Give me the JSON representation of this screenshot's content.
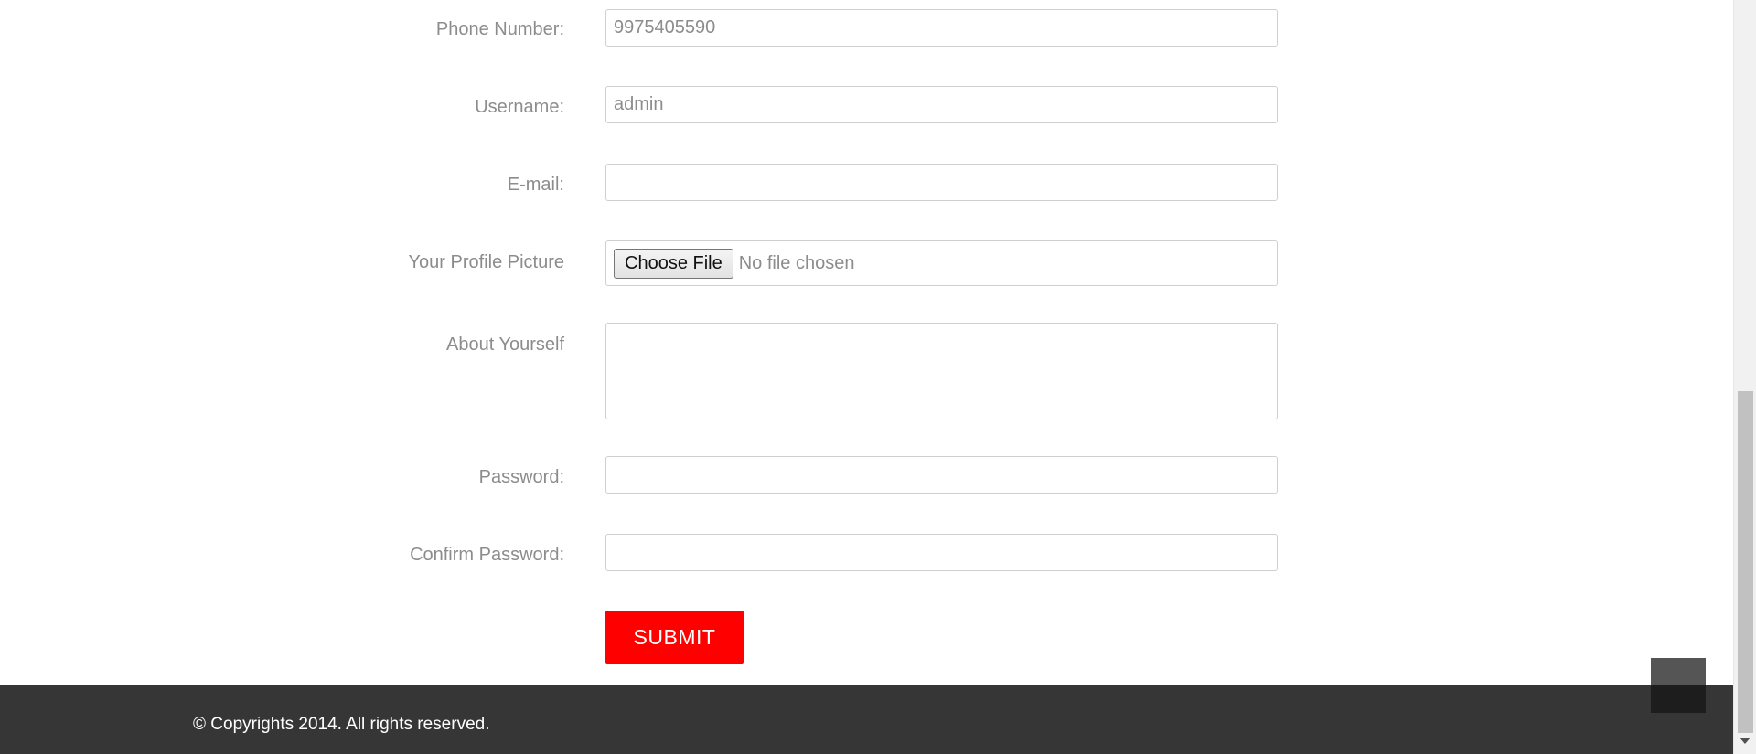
{
  "form": {
    "phone": {
      "label": "Phone Number:",
      "value": "9975405590"
    },
    "username": {
      "label": "Username:",
      "value": "admin"
    },
    "email": {
      "label": "E-mail:",
      "value": ""
    },
    "profile_picture": {
      "label": "Your Profile Picture",
      "button_label": "Choose File",
      "status": "No file chosen"
    },
    "about": {
      "label": "About Yourself",
      "value": ""
    },
    "password": {
      "label": "Password:",
      "value": ""
    },
    "confirm_password": {
      "label": "Confirm Password:",
      "value": ""
    },
    "submit_label": "SUBMIT"
  },
  "footer": {
    "copyright": "© Copyrights 2014. All rights reserved."
  },
  "colors": {
    "accent": "#fe0000",
    "footer_bg": "#363636",
    "label_text": "#8c8c8c"
  }
}
